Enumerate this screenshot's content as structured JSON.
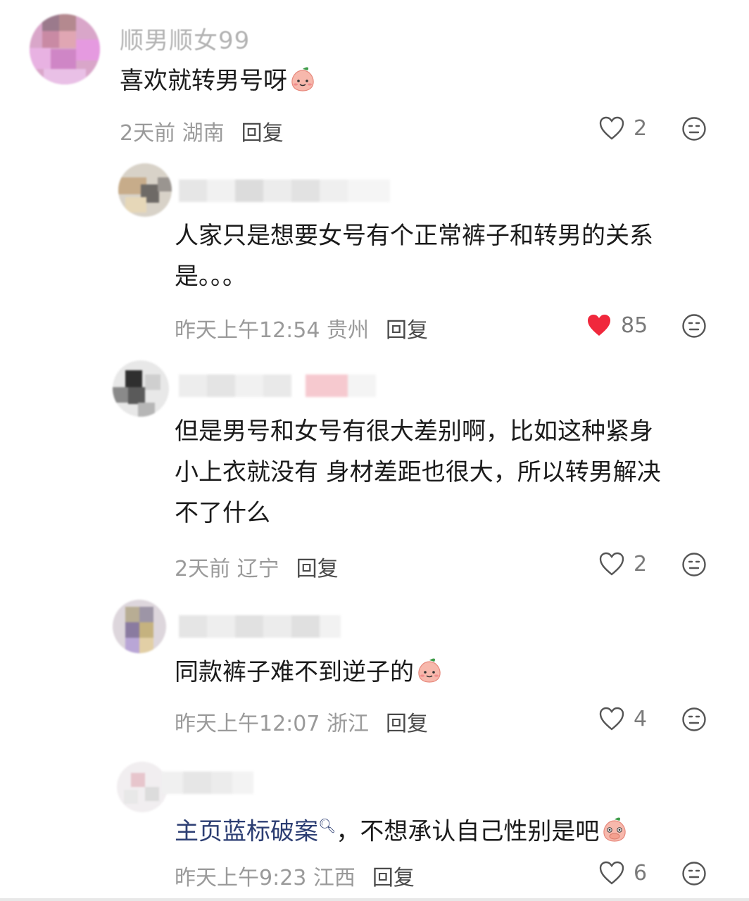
{
  "comments": [
    {
      "username": "顺男顺女99",
      "lines": [
        "喜欢就转男号呀"
      ],
      "emoji": "peach-smile",
      "time": "2天前",
      "location": "湖南",
      "reply": "回复",
      "likes": "2",
      "liked": false
    },
    {
      "username": "",
      "lines": [
        "人家只是想要女号有个正常裤子和转男的关系",
        "是。。。"
      ],
      "time": "昨天上午12:54",
      "location": "贵州",
      "reply": "回复",
      "likes": "85",
      "liked": true
    },
    {
      "username": "",
      "lines": [
        "但是男号和女号有很大差别啊，比如这种紧身",
        "小上衣就没有 身材差距也很大，所以转男解决",
        "不了什么"
      ],
      "time": "2天前",
      "location": "辽宁",
      "reply": "回复",
      "likes": "2",
      "liked": false
    },
    {
      "username": "",
      "lines": [
        "同款裤子难不到逆子的"
      ],
      "emoji": "peach-smile",
      "time": "昨天上午12:07",
      "location": "浙江",
      "reply": "回复",
      "likes": "4",
      "liked": false
    },
    {
      "username": "",
      "link_text": "主页蓝标破案",
      "lines": [
        "，不想承认自己性别是吧"
      ],
      "emoji": "peach-cover-mouth",
      "time": "昨天上午9:23",
      "location": "江西",
      "reply": "回复",
      "likes": "6",
      "liked": false
    }
  ],
  "icons": {
    "like": "heart-outline-icon",
    "liked": "heart-filled-icon",
    "dislike": "meh-face-icon",
    "link_search": "search-icon"
  },
  "colors": {
    "liked_heart": "#f0283c",
    "link": "#2c3e73",
    "meta": "#9a9a9a"
  }
}
